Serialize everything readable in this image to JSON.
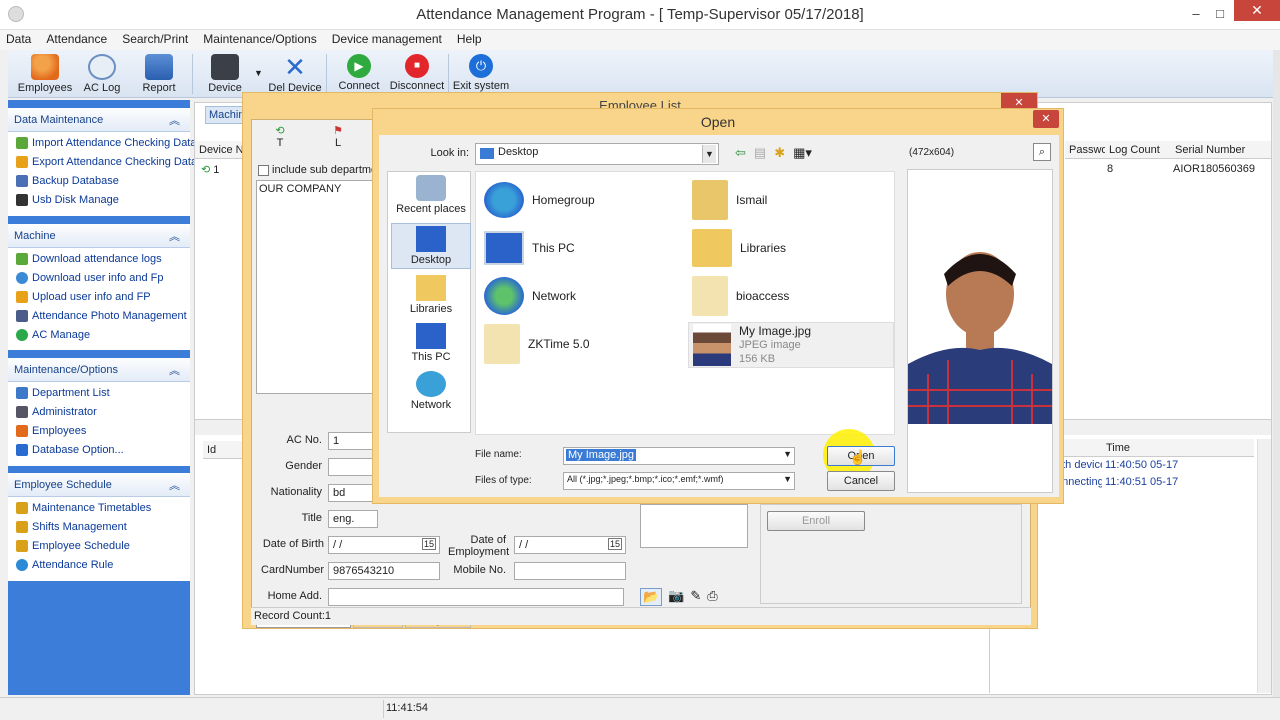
{
  "app": {
    "title": "Attendance Management Program - [ Temp-Supervisor 05/17/2018]"
  },
  "menu": [
    "Data",
    "Attendance",
    "Search/Print",
    "Maintenance/Options",
    "Device management",
    "Help"
  ],
  "toolbar": {
    "employees": "Employees",
    "ac_log": "AC Log",
    "report": "Report",
    "device": "Device",
    "del_device": "Del Device",
    "connect": "Connect",
    "disconnect": "Disconnect",
    "exit": "Exit system"
  },
  "sidebar": {
    "data_maintenance": {
      "title": "Data Maintenance",
      "items": [
        "Import Attendance Checking Data",
        "Export Attendance Checking Data",
        "Backup Database",
        "Usb Disk Manage"
      ]
    },
    "machine": {
      "title": "Machine",
      "items": [
        "Download attendance logs",
        "Download user info and Fp",
        "Upload user info and FP",
        "Attendance Photo Management",
        "AC Manage"
      ]
    },
    "maintenance": {
      "title": "Maintenance/Options",
      "items": [
        "Department List",
        "Administrator",
        "Employees",
        "Database Option..."
      ]
    },
    "schedule": {
      "title": "Employee Schedule",
      "items": [
        "Maintenance Timetables",
        "Shifts Management",
        "Employee Schedule",
        "Attendance Rule"
      ]
    }
  },
  "main": {
    "tab_label": "Machin",
    "device_table": {
      "col_device": "Device Na",
      "row_val": "1"
    },
    "right_table": {
      "headers": [
        "Passwo...",
        "Log Count",
        "Serial Number"
      ],
      "row": [
        "8",
        "AIOR180560369"
      ]
    },
    "id_header": "Id",
    "log_table": {
      "headers": [
        "s",
        "Time"
      ],
      "rows": [
        [
          "Connecting with device,pl",
          "11:40:50 05-17"
        ],
        [
          "Succeed in connecting wi",
          "11:40:51 05-17"
        ]
      ]
    }
  },
  "employee_list": {
    "title": "Employee List",
    "icon_t": "T",
    "icon_l": "L",
    "include_sub": "include sub departmen",
    "dept": "OUR COMPANY",
    "labels": {
      "ac_no": "AC No.",
      "gender": "Gender",
      "nationality": "Nationality",
      "title": "Title",
      "dob": "Date of Birth",
      "card": "CardNumber",
      "home": "Home Add.",
      "doe": "Date of\nEmployment",
      "mobile": "Mobile No."
    },
    "values": {
      "ac_no": "1",
      "nationality": "bd",
      "title": "eng.",
      "dob": " / /",
      "card": "9876543210",
      "doe": " / /"
    },
    "tabs": [
      "Basic Information",
      "Addition",
      "AC Options"
    ],
    "enroll": "Enroll",
    "record_count": "Record Count:1"
  },
  "open_dialog": {
    "title": "Open",
    "look_in_label": "Look in:",
    "look_in_value": "Desktop",
    "preview_size": "(472x604)",
    "places": [
      "Recent places",
      "Desktop",
      "Libraries",
      "This PC",
      "Network"
    ],
    "files": [
      {
        "name": "Homegroup",
        "type": "",
        "size": ""
      },
      {
        "name": "Ismail",
        "type": "",
        "size": ""
      },
      {
        "name": "This PC",
        "type": "",
        "size": ""
      },
      {
        "name": "Libraries",
        "type": "",
        "size": ""
      },
      {
        "name": "Network",
        "type": "",
        "size": ""
      },
      {
        "name": "bioaccess",
        "type": "",
        "size": ""
      },
      {
        "name": "ZKTime 5.0",
        "type": "",
        "size": ""
      },
      {
        "name": "My Image.jpg",
        "type": "JPEG image",
        "size": "156 KB"
      }
    ],
    "file_name_label": "File name:",
    "file_name_value": "My Image.jpg",
    "files_type_label": "Files of type:",
    "files_type_value": "All (*.jpg;*.jpeg;*.bmp;*.ico;*.emf;*.wmf)",
    "open_btn": "Open",
    "cancel_btn": "Cancel"
  },
  "statusbar": {
    "time": "11:41:54"
  },
  "colors": {
    "sidebar_bg": "#3b7dd8",
    "dialog_frame": "#f8d58a",
    "close_red": "#c7453b",
    "selected_text_bg": "#3a7bd5"
  }
}
